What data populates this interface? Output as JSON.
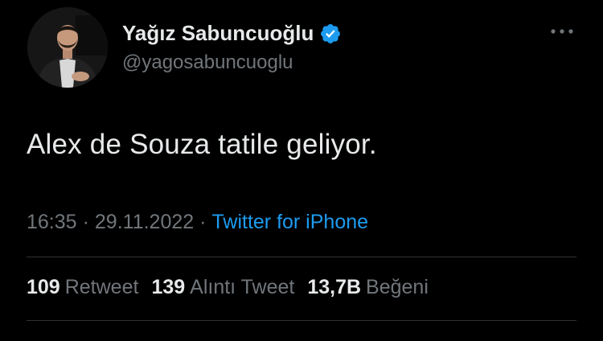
{
  "author": {
    "display_name": "Yağız Sabuncuoğlu",
    "username": "@yagosabuncuoglu",
    "verified_icon": "verified-badge-icon",
    "avatar": "profile-photo"
  },
  "tweet": {
    "text": "Alex de Souza tatile geliyor.",
    "time": "16:35",
    "separator": "·",
    "date": "29.11.2022",
    "source": "Twitter for iPhone"
  },
  "stats": {
    "retweets": {
      "count": "109",
      "label": "Retweet"
    },
    "quotes": {
      "count": "139",
      "label": "Alıntı Tweet"
    },
    "likes": {
      "count": "13,7B",
      "label": "Beğeni"
    }
  },
  "colors": {
    "background": "#000000",
    "primary_text": "#e7e9ea",
    "secondary_text": "#71767b",
    "link": "#1d9bf0",
    "verified": "#1d9bf0",
    "divider": "#2f3336"
  }
}
